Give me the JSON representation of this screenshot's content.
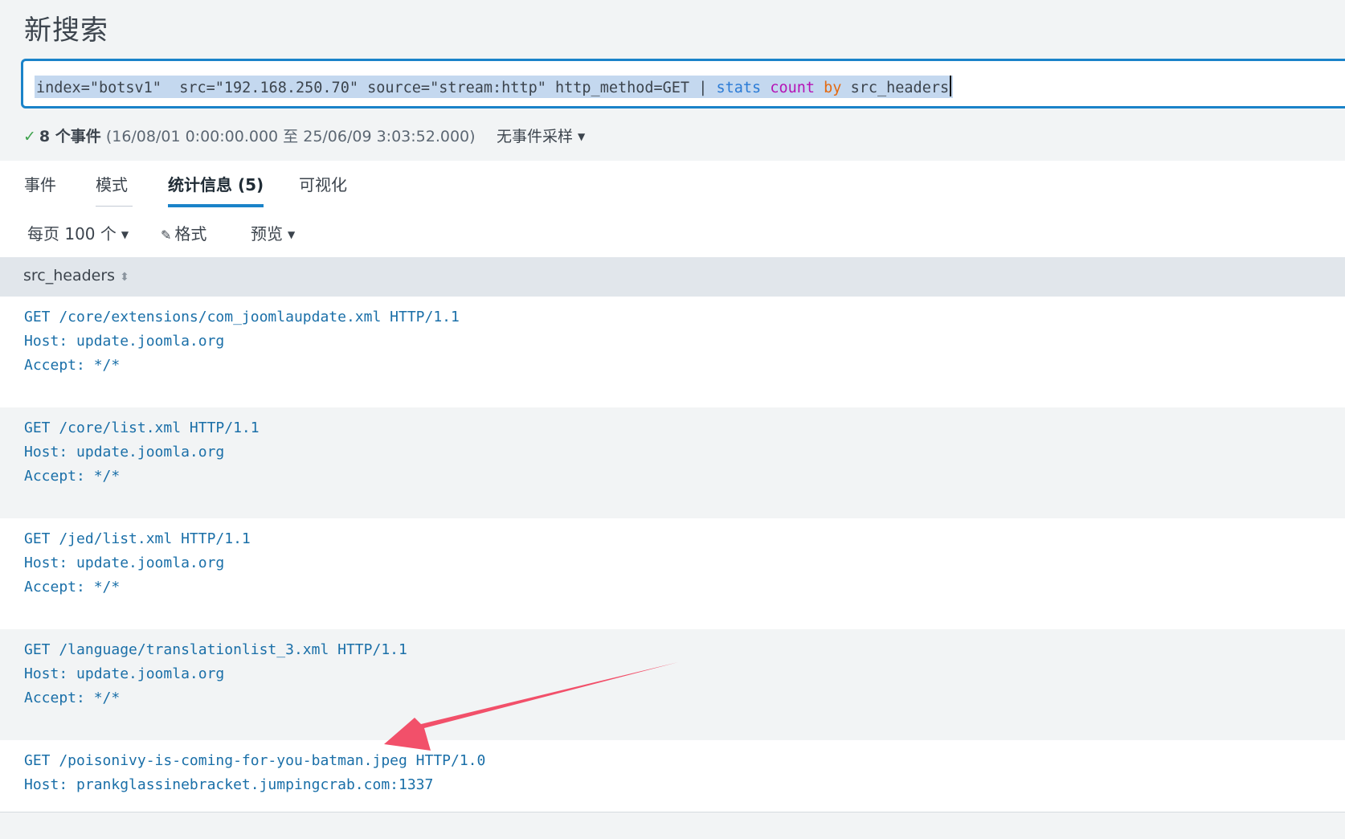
{
  "page": {
    "title": "新搜索"
  },
  "search": {
    "query_plain": "index=\"botsv1\"  src=\"192.168.250.70\" source=\"stream:http\" http_method=GET | ",
    "kw_stats": "stats",
    "kw_count": "count",
    "kw_by": "by",
    "query_tail": "src_headers"
  },
  "status": {
    "check": "✓",
    "count": "8 个事件",
    "range": "(16/08/01 0:00:00.000 至 25/06/09 3:03:52.000)",
    "sampling": "无事件采样"
  },
  "tabs": [
    {
      "label": "事件"
    },
    {
      "label": "模式"
    },
    {
      "label": "统计信息 (5)"
    },
    {
      "label": "可视化"
    }
  ],
  "toolbar": {
    "per_page": "每页 100 个",
    "format": "格式",
    "preview": "预览"
  },
  "table": {
    "column": "src_headers",
    "rows": [
      {
        "lines": [
          "GET /core/extensions/com_joomlaupdate.xml HTTP/1.1",
          "Host: update.joomla.org",
          "Accept: */*"
        ]
      },
      {
        "lines": [
          "GET /core/list.xml HTTP/1.1",
          "Host: update.joomla.org",
          "Accept: */*"
        ]
      },
      {
        "lines": [
          "GET /jed/list.xml HTTP/1.1",
          "Host: update.joomla.org",
          "Accept: */*"
        ]
      },
      {
        "lines": [
          "GET /language/translationlist_3.xml HTTP/1.1",
          "Host: update.joomla.org",
          "Accept: */*"
        ]
      },
      {
        "lines": [
          "GET /poisonivy-is-coming-for-you-batman.jpeg HTTP/1.0",
          "Host: prankglassinebracket.jumpingcrab.com:1337"
        ]
      }
    ]
  },
  "colors": {
    "accent": "#1a83c9",
    "link": "#1a6fa8",
    "arrow": "#f2506a"
  }
}
